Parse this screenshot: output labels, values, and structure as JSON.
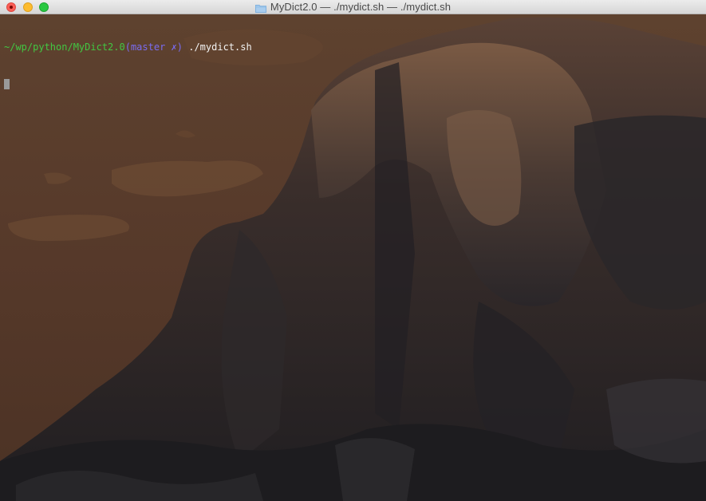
{
  "window": {
    "title": "MyDict2.0 — ./mydict.sh — ./mydict.sh",
    "folder_icon": "folder-icon"
  },
  "terminal": {
    "prompt": {
      "path": "~/wp/python/MyDict2.0",
      "open_paren": "(",
      "branch": "master",
      "dirty_marker": " ✗",
      "close_paren": ")",
      "command": " ./mydict.sh"
    }
  },
  "colors": {
    "prompt_path": "#42c742",
    "prompt_git": "#7a6cf0",
    "command_text": "#f2f2f2",
    "close_button": "#fc5f57",
    "minimize_button": "#fdbc2e",
    "zoom_button": "#28c840"
  }
}
